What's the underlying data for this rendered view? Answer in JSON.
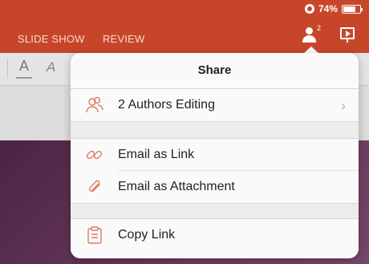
{
  "status_bar": {
    "battery_percent": "74%",
    "battery_level": 0.74,
    "rotation_lock_icon": "rotation-lock-icon"
  },
  "ribbon": {
    "tabs": [
      {
        "label": "SLIDE SHOW"
      },
      {
        "label": "REVIEW"
      }
    ],
    "share_button": {
      "icon": "person-icon",
      "count": "2"
    },
    "present_button": {
      "icon": "present-icon"
    }
  },
  "toolbar": {
    "font_color_glyph": "A",
    "highlight_glyph": "A"
  },
  "share_popover": {
    "title": "Share",
    "items": [
      {
        "label": "2 Authors Editing",
        "icon": "people-icon",
        "chevron": "›"
      },
      {
        "label": "Email as Link",
        "icon": "link-icon"
      },
      {
        "label": "Email as Attachment",
        "icon": "paperclip-icon"
      },
      {
        "label": "Copy Link",
        "icon": "clipboard-icon"
      }
    ]
  },
  "colors": {
    "ribbon": "#c7462a",
    "icon_accent": "#e07a5f",
    "slide": "#5a2f50"
  }
}
